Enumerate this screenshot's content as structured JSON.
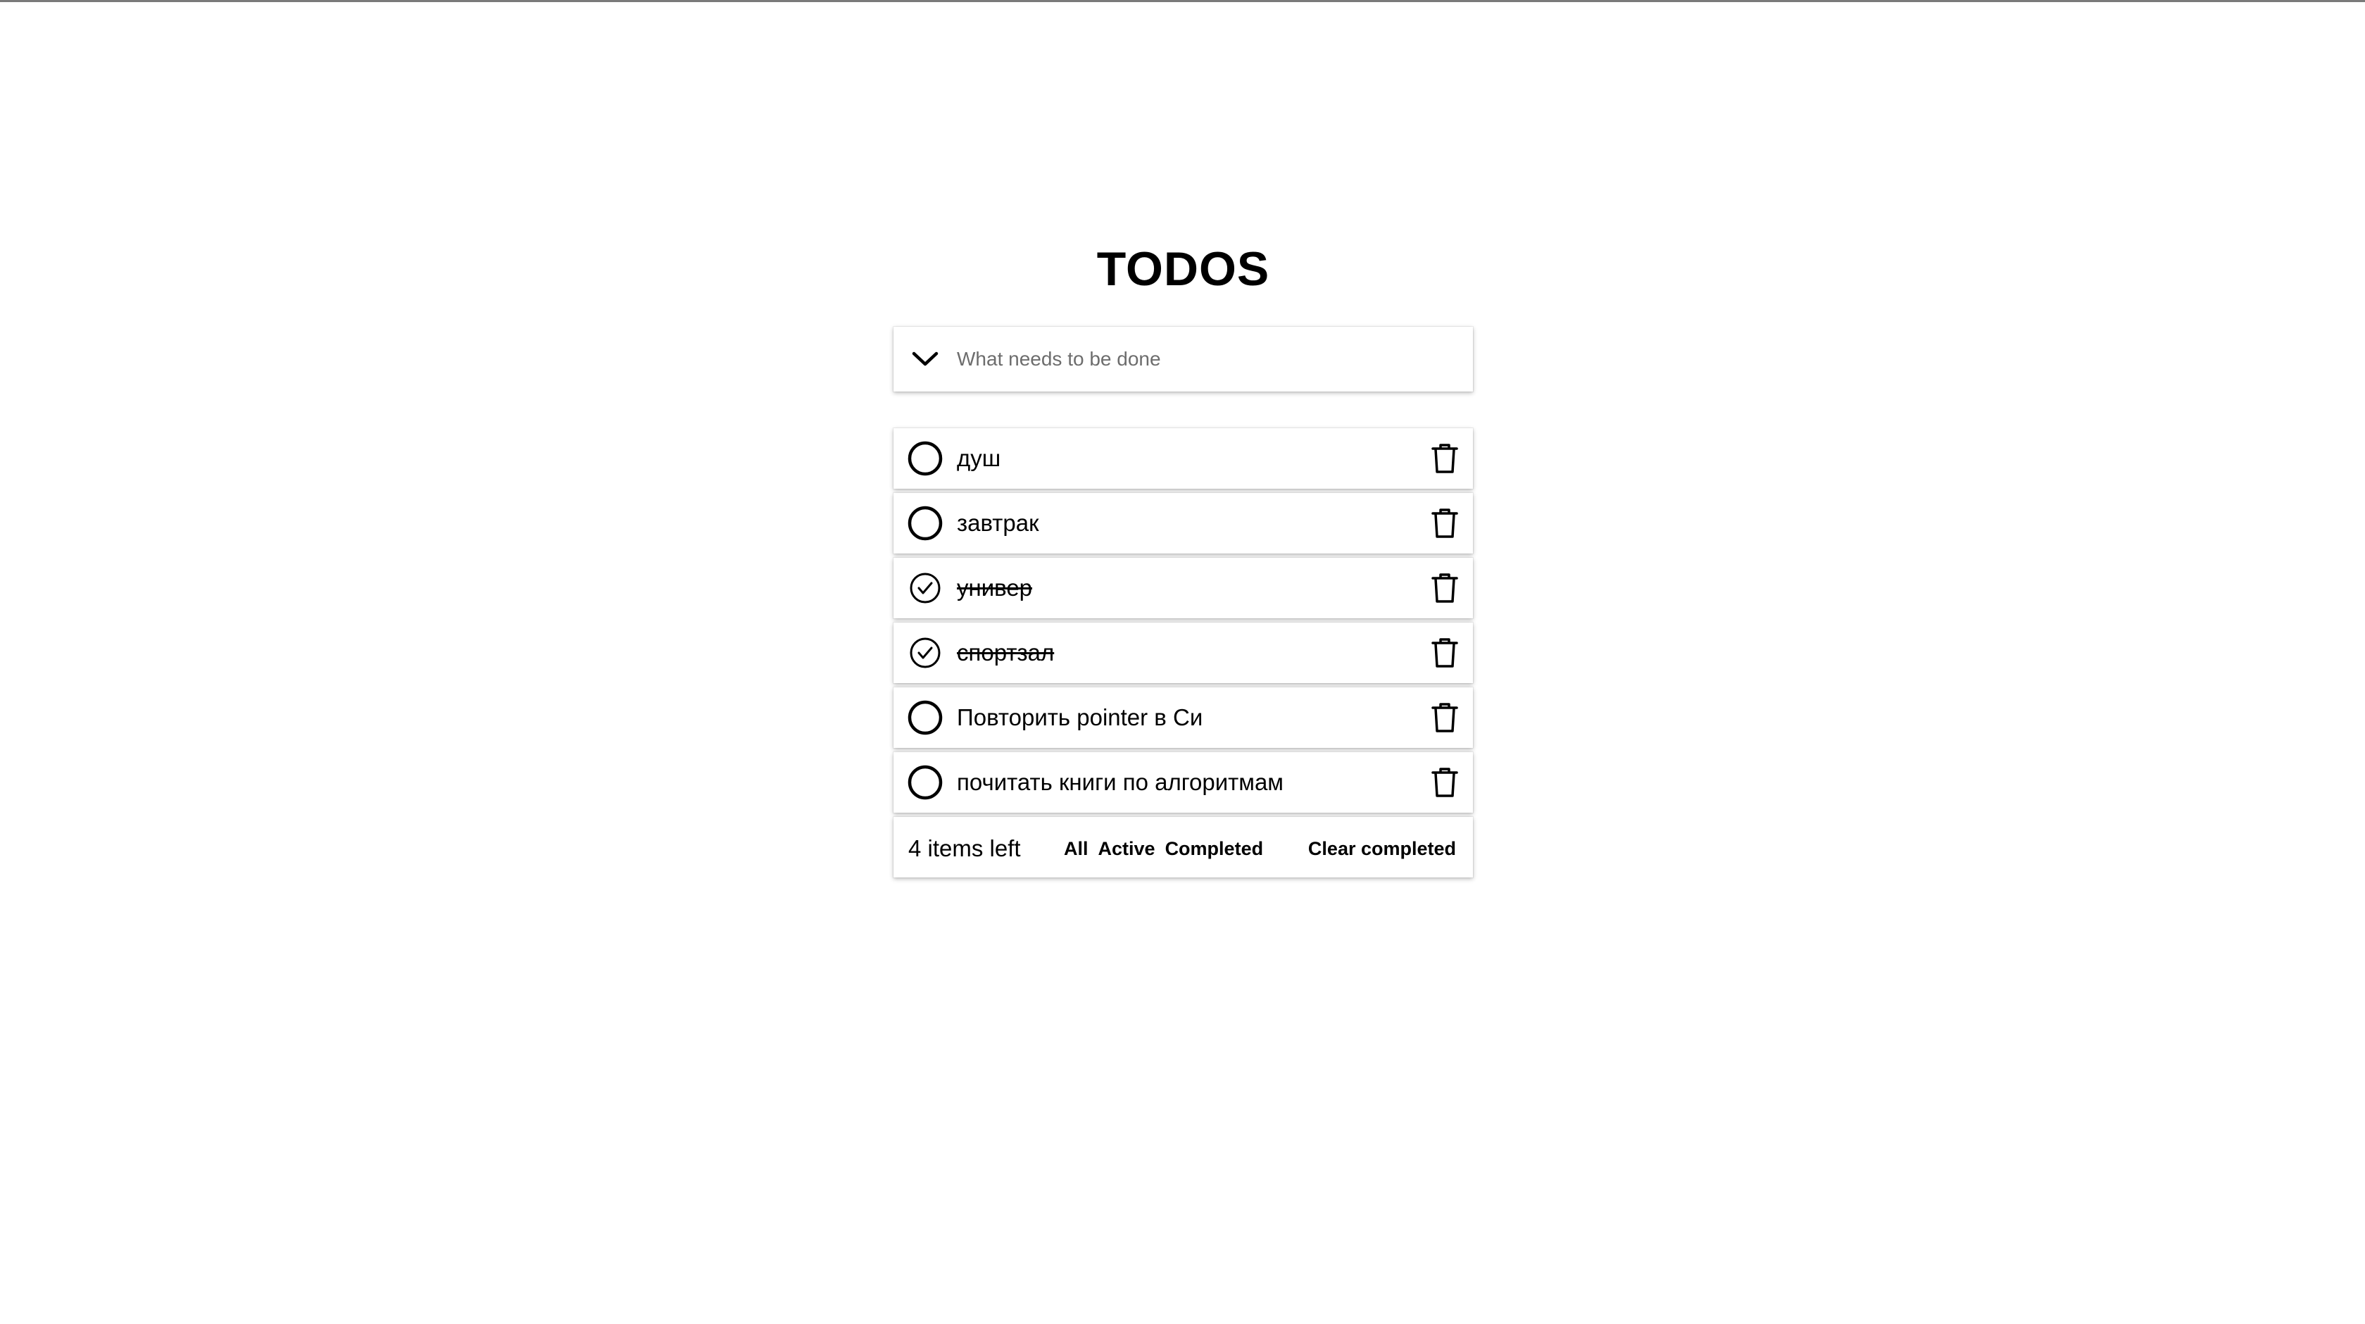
{
  "app": {
    "title": "TODOS"
  },
  "input": {
    "placeholder": "What needs to be done",
    "value": ""
  },
  "todos": [
    {
      "text": "душ",
      "completed": false
    },
    {
      "text": "завтрак",
      "completed": false
    },
    {
      "text": "универ",
      "completed": true
    },
    {
      "text": "спортзал",
      "completed": true
    },
    {
      "text": "Повторить pointer в Си",
      "completed": false
    },
    {
      "text": "почитать книги по алгоритмам",
      "completed": false
    }
  ],
  "footer": {
    "items_left": "4 items left",
    "filters": [
      "All",
      "Active",
      "Completed"
    ],
    "clear_label": "Clear completed"
  },
  "icons": {
    "toggle_all": "chevron-down-icon",
    "unchecked": "circle-icon",
    "checked": "check-circle-icon",
    "delete": "trash-icon"
  }
}
